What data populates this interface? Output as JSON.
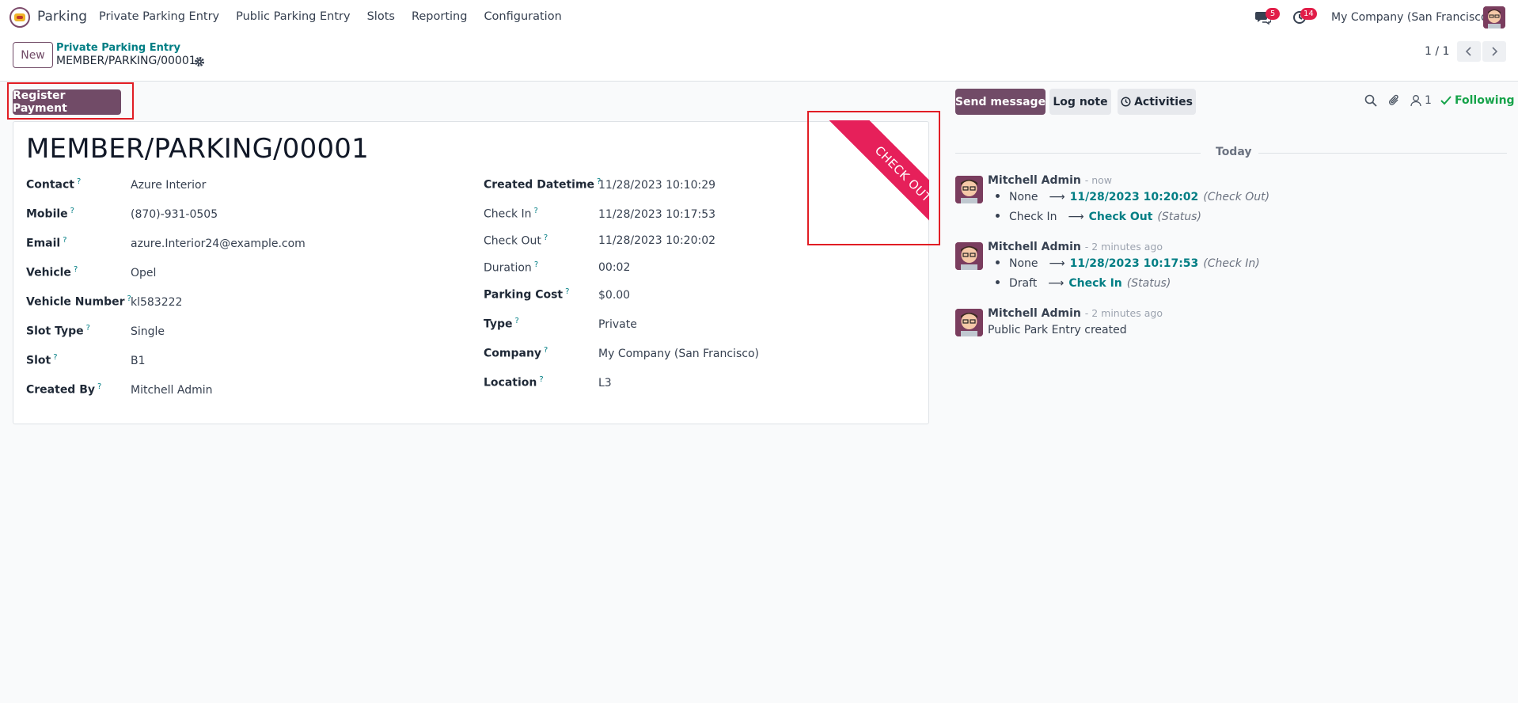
{
  "navbar": {
    "app_name": "Parking",
    "menu": [
      "Private Parking Entry",
      "Public Parking Entry",
      "Slots",
      "Reporting",
      "Configuration"
    ],
    "messages_badge": "5",
    "activities_badge": "14",
    "company": "My Company (San Francisco)"
  },
  "control_panel": {
    "new_label": "New",
    "breadcrumb": "Private Parking Entry",
    "record_name": "MEMBER/PARKING/00001",
    "pager": "1 / 1"
  },
  "statusbar": {
    "register_payment": "Register Payment"
  },
  "form": {
    "title": "MEMBER/PARKING/00001",
    "ribbon": "CHECK OUT",
    "left_fields": [
      {
        "label": "Contact",
        "value": "Azure Interior"
      },
      {
        "label": "Mobile",
        "value": "(870)-931-0505"
      },
      {
        "label": "Email",
        "value": "azure.Interior24@example.com"
      },
      {
        "label": "Vehicle",
        "value": "Opel"
      },
      {
        "label": "Vehicle Number",
        "value": "kl583222"
      },
      {
        "label": "Slot Type",
        "value": "Single"
      },
      {
        "label": "Slot",
        "value": "B1"
      },
      {
        "label": "Created By",
        "value": "Mitchell Admin"
      }
    ],
    "right_fields": [
      {
        "label": "Created Datetime",
        "value": "11/28/2023 10:10:29"
      },
      {
        "label": "Check In",
        "value": "11/28/2023 10:17:53"
      },
      {
        "label": "Check Out",
        "value": "11/28/2023 10:20:02"
      },
      {
        "label": "Duration",
        "value": "00:02"
      },
      {
        "label": "Parking Cost",
        "value": "$0.00"
      },
      {
        "label": "Type",
        "value": "Private"
      },
      {
        "label": "Company",
        "value": "My Company (San Francisco)"
      },
      {
        "label": "Location",
        "value": "L3"
      }
    ],
    "help_mark": "?"
  },
  "chatter": {
    "send_message": "Send message",
    "log_note": "Log note",
    "activities": "Activities",
    "followers_count": "1",
    "following": "Following",
    "separator": "Today",
    "messages": [
      {
        "author": "Mitchell Admin",
        "time": "- now",
        "tracking": [
          {
            "old": "None",
            "new": "11/28/2023 10:20:02",
            "field": "(Check Out)"
          },
          {
            "old": "Check In",
            "new": "Check Out",
            "field": "(Status)"
          }
        ]
      },
      {
        "author": "Mitchell Admin",
        "time": "- 2 minutes ago",
        "tracking": [
          {
            "old": "None",
            "new": "11/28/2023 10:17:53",
            "field": "(Check In)"
          },
          {
            "old": "Draft",
            "new": "Check In",
            "field": "(Status)"
          }
        ]
      },
      {
        "author": "Mitchell Admin",
        "time": "- 2 minutes ago",
        "body": "Public Park Entry created"
      }
    ]
  },
  "colors": {
    "brand": "#714b67",
    "accent": "#017e84",
    "ribbon": "#e6205a",
    "following": "#16a34a",
    "badge": "#e11d48",
    "highlight": "#e11d24"
  }
}
